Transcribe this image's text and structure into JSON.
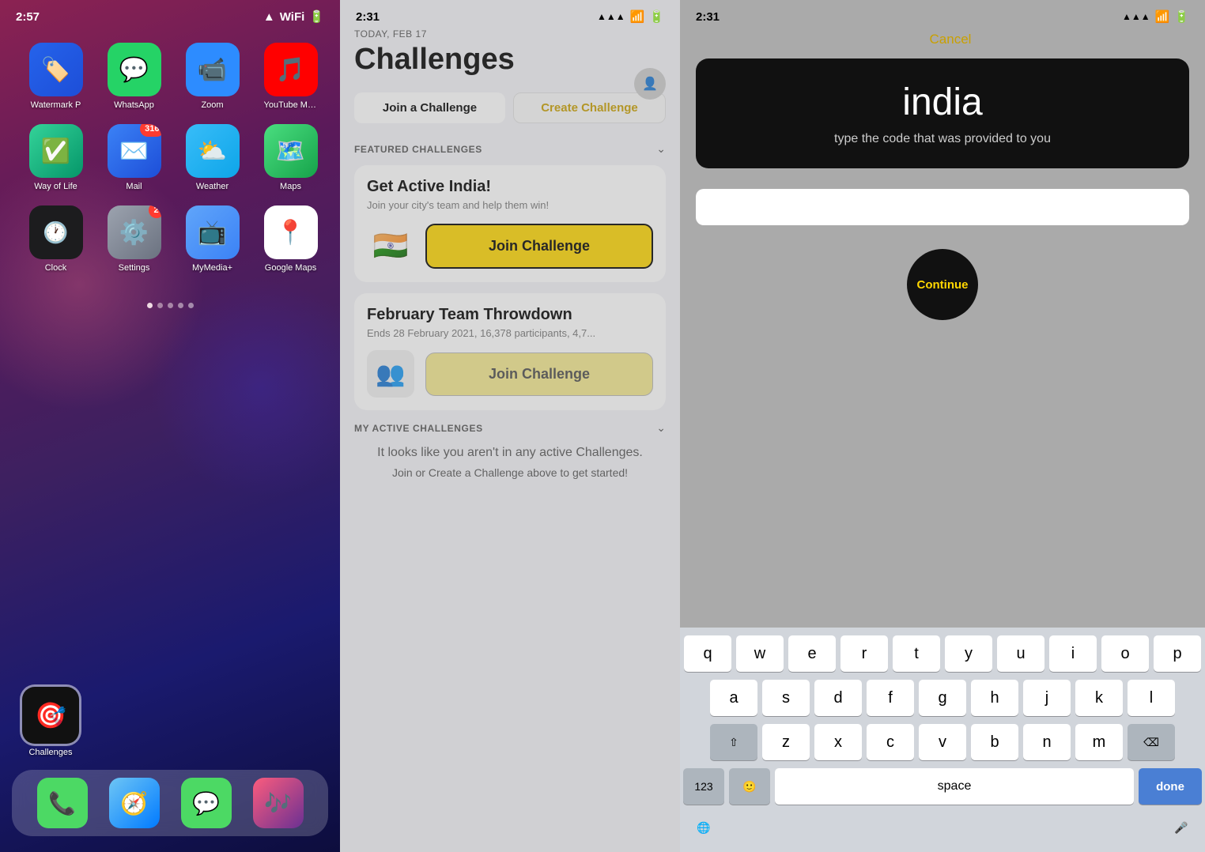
{
  "screen1": {
    "time": "2:57",
    "apps": [
      {
        "id": "watermark",
        "label": "Watermark P",
        "bg": "bg-watermark",
        "emoji": "🏷️",
        "badge": null
      },
      {
        "id": "whatsapp",
        "label": "WhatsApp",
        "bg": "bg-whatsapp",
        "emoji": "💬",
        "badge": null
      },
      {
        "id": "zoom",
        "label": "Zoom",
        "bg": "bg-zoom",
        "emoji": "📹",
        "badge": null
      },
      {
        "id": "ytmusic",
        "label": "YouTube Music",
        "bg": "bg-ytmusic",
        "emoji": "🎵",
        "badge": null
      },
      {
        "id": "wayoflife",
        "label": "Way of Life",
        "bg": "bg-wayoflife",
        "emoji": "✅",
        "badge": null
      },
      {
        "id": "mail",
        "label": "Mail",
        "bg": "bg-mail",
        "emoji": "✉️",
        "badge": "316"
      },
      {
        "id": "weather",
        "label": "Weather",
        "bg": "bg-weather",
        "emoji": "⛅",
        "badge": null
      },
      {
        "id": "maps",
        "label": "Maps",
        "bg": "bg-maps",
        "emoji": "🗺️",
        "badge": null
      },
      {
        "id": "clock",
        "label": "Clock",
        "bg": "bg-clock",
        "emoji": "🕐",
        "badge": null
      },
      {
        "id": "settings",
        "label": "Settings",
        "bg": "bg-settings",
        "emoji": "⚙️",
        "badge": "2"
      },
      {
        "id": "mymedia",
        "label": "MyMedia+",
        "bg": "bg-mymedia",
        "emoji": "📺",
        "badge": null
      },
      {
        "id": "googlemaps",
        "label": "Google Maps",
        "bg": "bg-googlemaps",
        "emoji": "📍",
        "badge": null
      }
    ],
    "highlighted_app": {
      "label": "Challenges",
      "bg": "bg-challenges",
      "emoji": "🎯"
    },
    "dock": [
      {
        "id": "phone",
        "bg": "bg-phone",
        "emoji": "📞"
      },
      {
        "id": "safari",
        "bg": "bg-safari",
        "emoji": "🧭"
      },
      {
        "id": "messages",
        "bg": "bg-messages",
        "emoji": "💬"
      },
      {
        "id": "music",
        "bg": "bg-music",
        "emoji": "🎶"
      }
    ]
  },
  "screen2": {
    "time": "2:31",
    "date_label": "TODAY, FEB 17",
    "title": "Challenges",
    "tab_join": "Join a Challenge",
    "tab_create": "Create Challenge",
    "featured_section": "FEATURED CHALLENGES",
    "challenge1": {
      "title": "Get Active India!",
      "subtitle": "Join your city's team and help them win!",
      "flag": "🇮🇳",
      "btn_label": "Join Challenge"
    },
    "challenge2": {
      "title": "February Team Throwdown",
      "subtitle": "Ends 28 February 2021, 16,378 participants, 4,7...",
      "flag": "👥",
      "btn_label": "Join Challenge"
    },
    "active_section": "MY ACTIVE CHALLENGES",
    "active_empty1": "It looks like you aren't in any active Challenges.",
    "active_cta": "Join or Create a Challenge above to get started!"
  },
  "screen3": {
    "time": "2:31",
    "cancel_label": "Cancel",
    "code_word": "india",
    "code_hint": "type the code that was provided to you",
    "input_value": "",
    "continue_label": "Continue",
    "keyboard": {
      "row1": [
        "q",
        "w",
        "e",
        "r",
        "t",
        "y",
        "u",
        "i",
        "o",
        "p"
      ],
      "row2": [
        "a",
        "s",
        "d",
        "f",
        "g",
        "h",
        "j",
        "k",
        "l"
      ],
      "row3": [
        "z",
        "x",
        "c",
        "v",
        "b",
        "n",
        "m"
      ],
      "shift": "⇧",
      "delete": "⌫",
      "num_label": "123",
      "emoji_label": "🙂",
      "space_label": "space",
      "done_label": "done",
      "globe_label": "🌐",
      "mic_label": "🎤"
    }
  }
}
